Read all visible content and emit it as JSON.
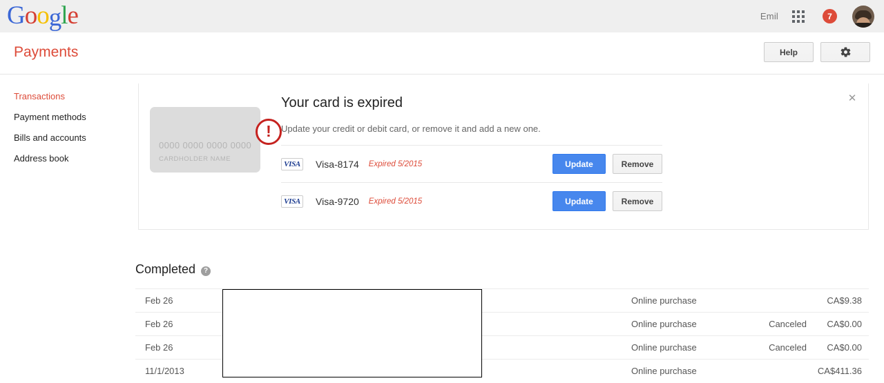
{
  "gbar": {
    "logo_letters": [
      "G",
      "o",
      "o",
      "g",
      "l",
      "e"
    ],
    "user_name": "Emil",
    "apps_icon": "apps-grid-icon",
    "notification_count": "7",
    "avatar_icon": "user-avatar"
  },
  "header": {
    "title": "Payments",
    "help_label": "Help",
    "settings_icon": "gear-icon"
  },
  "sidebar": {
    "items": [
      {
        "label": "Transactions",
        "active": true
      },
      {
        "label": "Payment methods",
        "active": false
      },
      {
        "label": "Bills and accounts",
        "active": false
      },
      {
        "label": "Address book",
        "active": false
      }
    ]
  },
  "alert": {
    "close_icon": "close-icon",
    "warning_icon": "exclamation-circle-icon",
    "card_art": {
      "number_placeholder": "0000 0000 0000 0000",
      "name_placeholder": "CARDHOLDER NAME"
    },
    "heading": "Your card is expired",
    "subtext": "Update your credit or debit card, or remove it and add a new one.",
    "cards": [
      {
        "brand": "VISA",
        "name": "Visa-8174",
        "expiry": "Expired 5/2015",
        "update_label": "Update",
        "remove_label": "Remove"
      },
      {
        "brand": "VISA",
        "name": "Visa-9720",
        "expiry": "Expired 5/2015",
        "update_label": "Update",
        "remove_label": "Remove"
      }
    ]
  },
  "completed": {
    "title": "Completed",
    "help_icon": "help-circle-icon",
    "help_glyph": "?",
    "rows": [
      {
        "date": "Feb 26",
        "description": "",
        "type": "Online purchase",
        "status": "",
        "amount": "CA$9.38"
      },
      {
        "date": "Feb 26",
        "description": "",
        "type": "Online purchase",
        "status": "Canceled",
        "amount": "CA$0.00"
      },
      {
        "date": "Feb 26",
        "description": "",
        "type": "Online purchase",
        "status": "Canceled",
        "amount": "CA$0.00"
      },
      {
        "date": "11/1/2013",
        "description": "",
        "type": "Online purchase",
        "status": "",
        "amount": "CA$411.36"
      }
    ]
  },
  "colors": {
    "brand_red": "#dd4b39",
    "button_blue": "#4787ed",
    "warning_red": "#c5221f",
    "bar_bg": "#efefef"
  }
}
